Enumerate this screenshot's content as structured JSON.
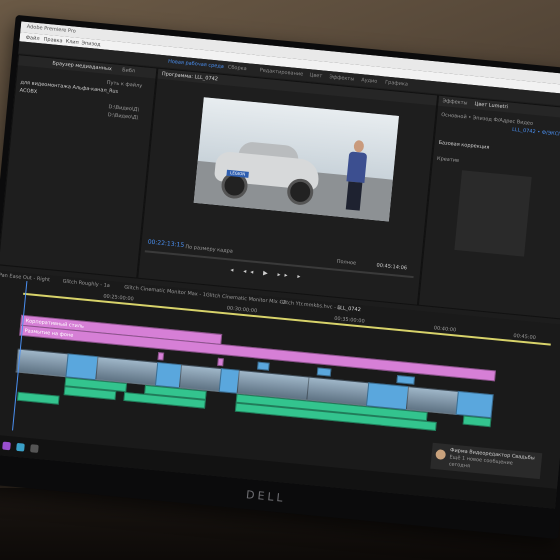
{
  "app": {
    "title": "Adobe Premiere Pro",
    "menu": [
      "Файл",
      "Правка",
      "Клип",
      "Эпизод",
      "Маркеры",
      "Графика",
      "Окно",
      "Справка"
    ]
  },
  "workspace": {
    "tabs": [
      "Новая рабочая среда",
      "Сборка",
      "Редактирование",
      "Цвет",
      "Эффекты",
      "Аудио",
      "Графика"
    ],
    "active": 0
  },
  "project_panel": {
    "tabs": [
      "Браузер медиаданных",
      "Библ"
    ],
    "items": [
      "для видеомонтажа Альфа-канал_Rus",
      "ACOBX"
    ],
    "path_header": "Путь к файлу",
    "paths": [
      "D:\\Видео\\Д\\",
      "D:\\Видео\\Д\\"
    ]
  },
  "program_monitor": {
    "tab": "Программа: LLL_0742",
    "timecode_left": "00:22:13:15",
    "fit_label": "По размеру кадра",
    "quality": "Полное",
    "timecode_right": "00:45:14:06",
    "plate_text": "LEGION"
  },
  "right_panel": {
    "tabs": [
      "Эффекты",
      "Цвет Lumetri"
    ],
    "line1": "Основной • Эпизод Ф/Адрес Видео",
    "line2": "LLL_0742 • Ф/ЭКСПОРТ",
    "section": "Базовая коррекция",
    "sub": "Креатив"
  },
  "sequence_tabs": [
    "Pan Ease Out - Right",
    "Glitch Roughly - 1a",
    "Glitch Cinematic Monitor Max - 1",
    "Glitch Cinematic Monitor Mix - 2",
    "Glitch Ytr.mmkbs.hvc - 3",
    "LLL_0742"
  ],
  "ruler": [
    "00:25:00:00",
    "00:30:00:00",
    "00:35:00:00",
    "00:40:00",
    "00:45:00"
  ],
  "tracks": {
    "pink_label1": "Корпоративный стиль",
    "pink_label2": "Размытие на фоне",
    "video_clips": 16,
    "audio_clips": 10
  },
  "notification": {
    "name": "Фирма Видеоредактор Свадьбы",
    "line": "Ещё 1 новое сообщение",
    "sub": "сегодня"
  },
  "monitor_brand": "DELL"
}
